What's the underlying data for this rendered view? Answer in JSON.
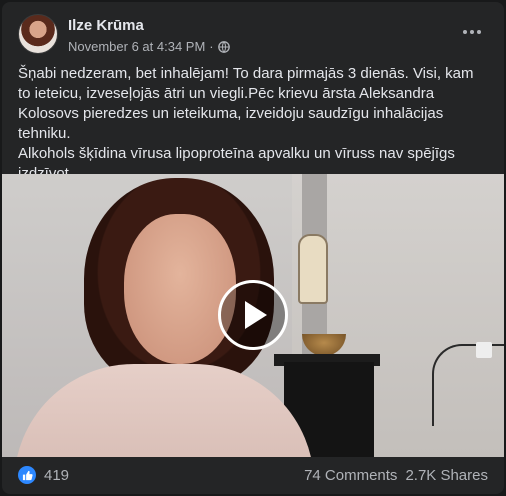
{
  "post": {
    "author": "Ilze Krūma",
    "timestamp": "November 6 at 4:34 PM",
    "separator": "·",
    "privacy_icon": "globe-icon",
    "text": [
      "Šņabi nedzeram, bet inhalējam! To dara pirmajās 3 dienās. Visi, kam to ieteicu, izveseļojās ātri un viegli.Pēc krievu ārsta Aleksandra Kolosovs pieredzes un ieteikuma, izveidoju saudzīgu inhalācijas tehniku.",
      "Alkohols šķīdina vīrusa lipoproteīna apvalku un vīruss nav spējīgs izdzīvot."
    ],
    "video": {
      "play_icon": "play-icon"
    },
    "reactions": {
      "icon": "like-icon",
      "count": "419"
    },
    "comments": "74 Comments",
    "shares": "2.7K Shares",
    "colors": {
      "accent": "#2d88ff",
      "card_bg": "#242526",
      "text": "#e4e6eb",
      "muted": "#b0b3b8"
    }
  }
}
